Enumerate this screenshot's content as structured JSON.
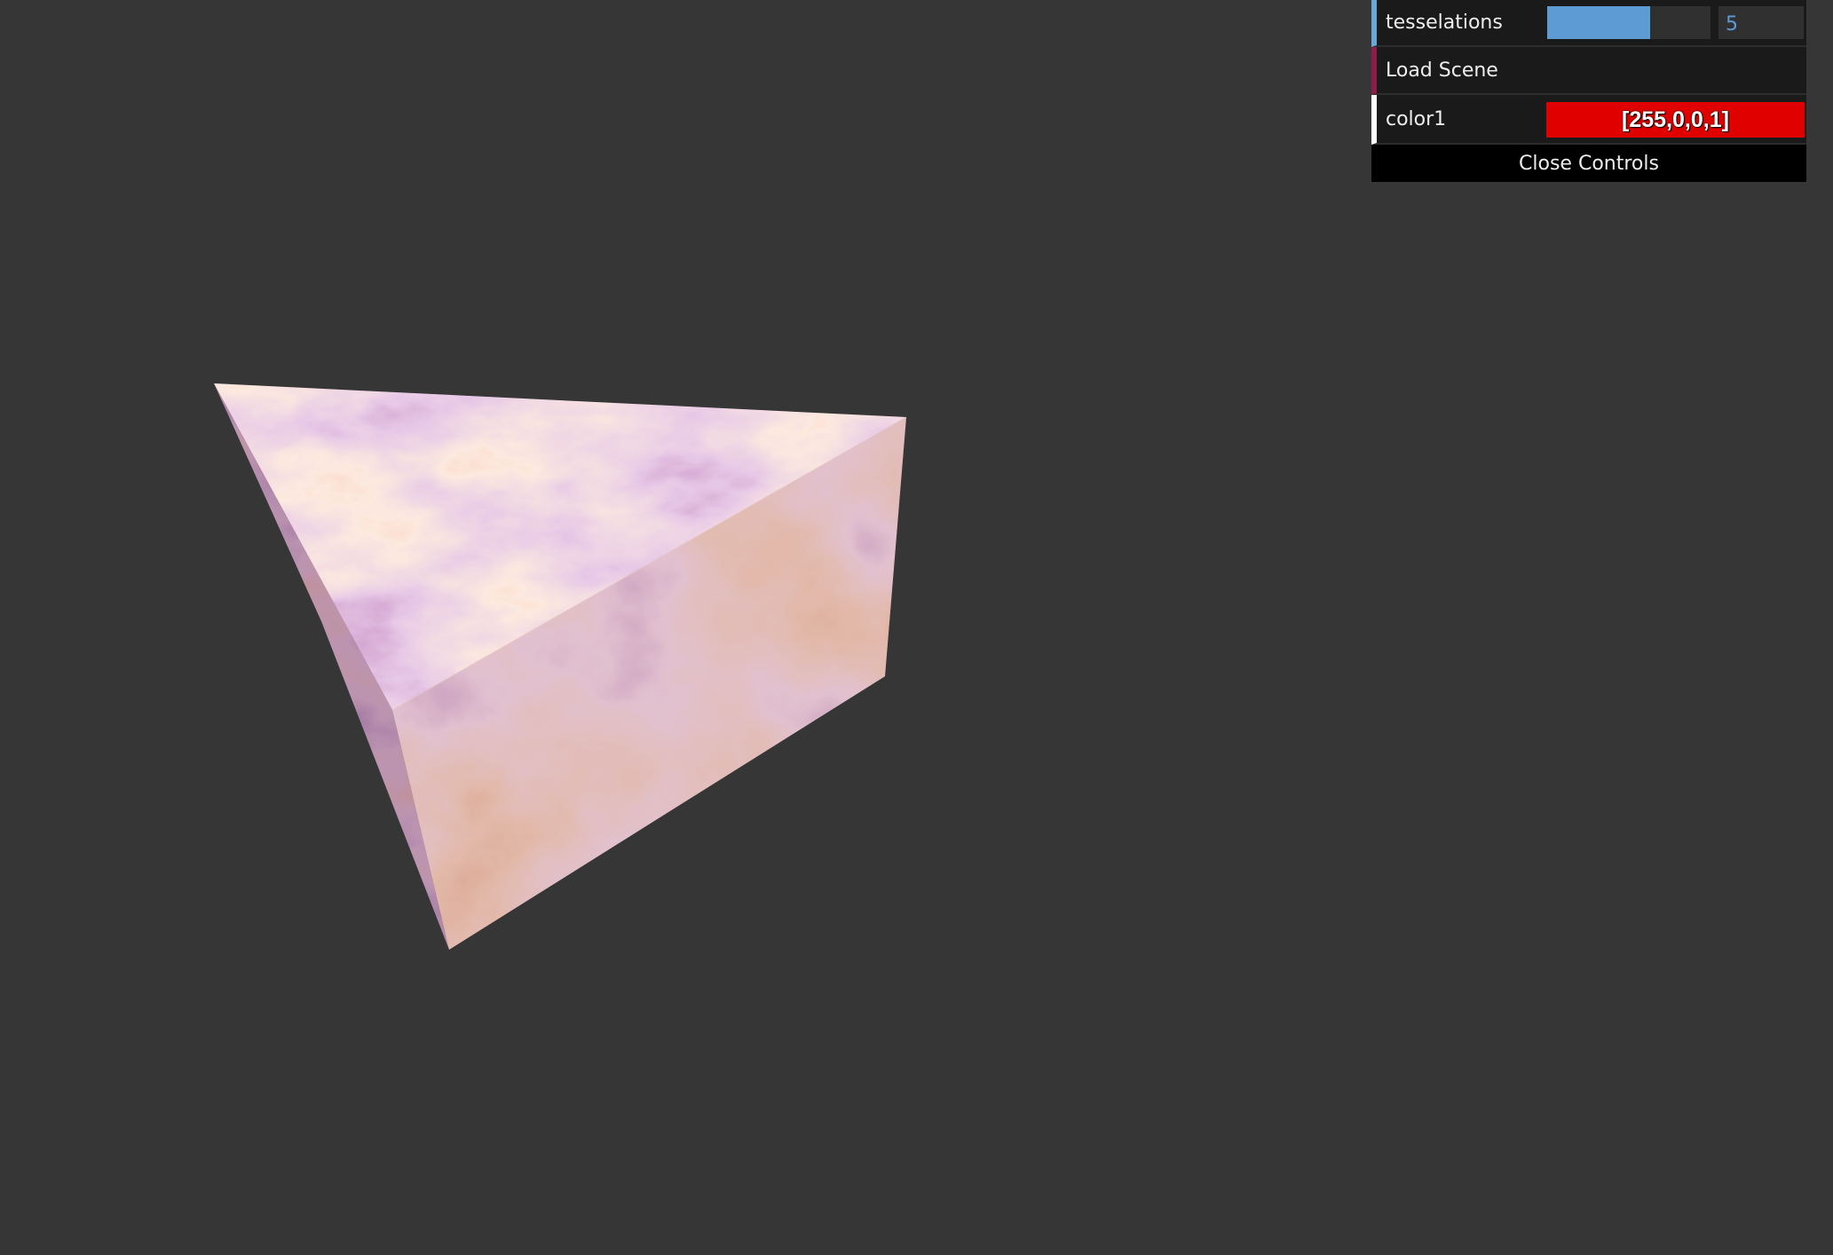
{
  "scene": {
    "background_color": "#363636",
    "object_shape": "triangular-prism",
    "texture_palette": [
      "#5a1248",
      "#7b3f8a",
      "#b88ac4",
      "#f3c7b0",
      "#d0703c",
      "#a8441c"
    ]
  },
  "gui": {
    "tesselations": {
      "label": "tesselations",
      "value": "5",
      "slider_fraction": 0.63,
      "accent_color": "#5d9bd5"
    },
    "load_scene": {
      "label": "Load Scene",
      "accent_color": "#8e1b4a"
    },
    "color1": {
      "label": "color1",
      "value": "[255,0,0,1]",
      "swatch_color": "#e00000"
    },
    "close_label": "Close Controls"
  }
}
